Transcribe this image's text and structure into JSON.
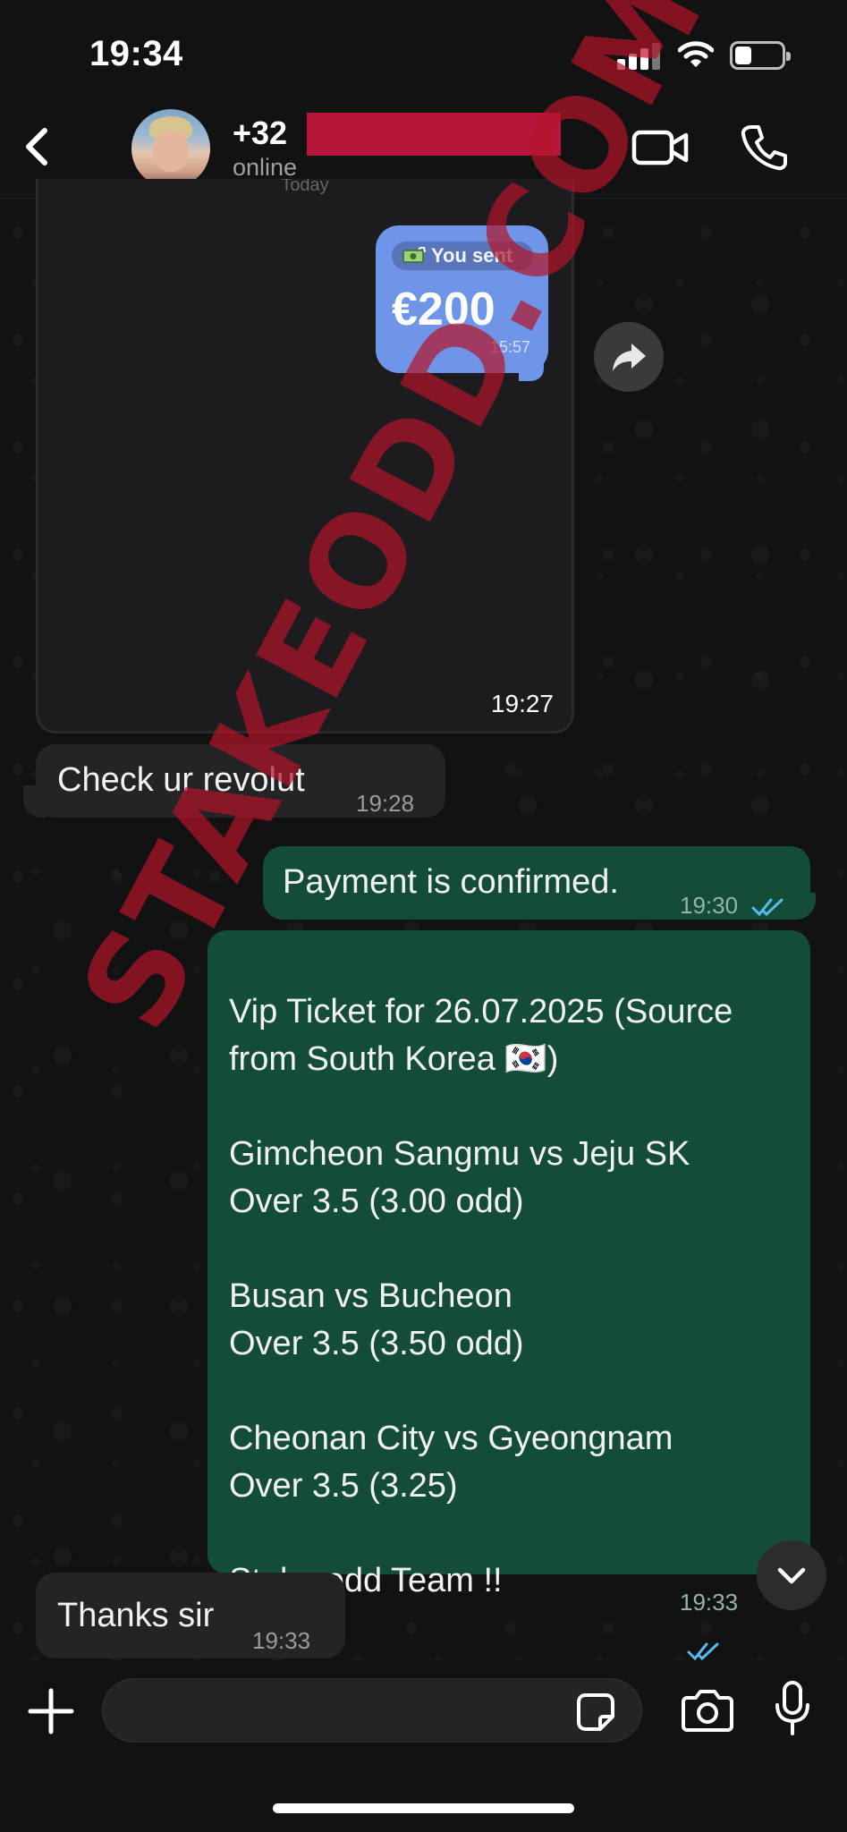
{
  "status_bar": {
    "time": "19:34"
  },
  "header": {
    "contact_prefix": "+32",
    "contact_status": "online"
  },
  "media_message": {
    "top_label": "Today",
    "revolut_label": "You sent",
    "revolut_amount": "€200",
    "revolut_time": "15:57",
    "time": "19:27"
  },
  "messages": [
    {
      "text": "Check ur revolut",
      "time": "19:28",
      "direction": "incoming"
    },
    {
      "text": "Payment is confirmed.",
      "time": "19:30",
      "direction": "outgoing",
      "read": true
    },
    {
      "text": "Vip Ticket for 26.07.2025 (Source from South Korea 🇰🇷)\n\nGimcheon Sangmu vs Jeju SK\nOver 3.5 (3.00 odd)\n\nBusan vs Bucheon\nOver 3.5 (3.50 odd)\n\nCheonan City vs Gyeongnam\nOver 3.5 (3.25)\n\nStake odd Team !!",
      "time": "19:33",
      "direction": "outgoing",
      "read": true
    },
    {
      "text": "Thanks sir",
      "time": "19:33",
      "direction": "incoming"
    }
  ],
  "watermark": "STAKEODD.COM",
  "colors": {
    "outgoing_bubble": "#144d37",
    "incoming_bubble": "#242426",
    "revolut_bubble": "#6f95e8",
    "read_ticks": "#53bdeb",
    "redaction": "#b5163a"
  },
  "icons": {
    "back": "chevron-left-icon",
    "video": "video-camera-icon",
    "call": "phone-icon",
    "forward": "forward-arrow-icon",
    "scroll": "chevron-down-icon",
    "attach": "plus-icon",
    "sticker": "sticker-icon",
    "camera": "camera-icon",
    "mic": "microphone-icon"
  }
}
